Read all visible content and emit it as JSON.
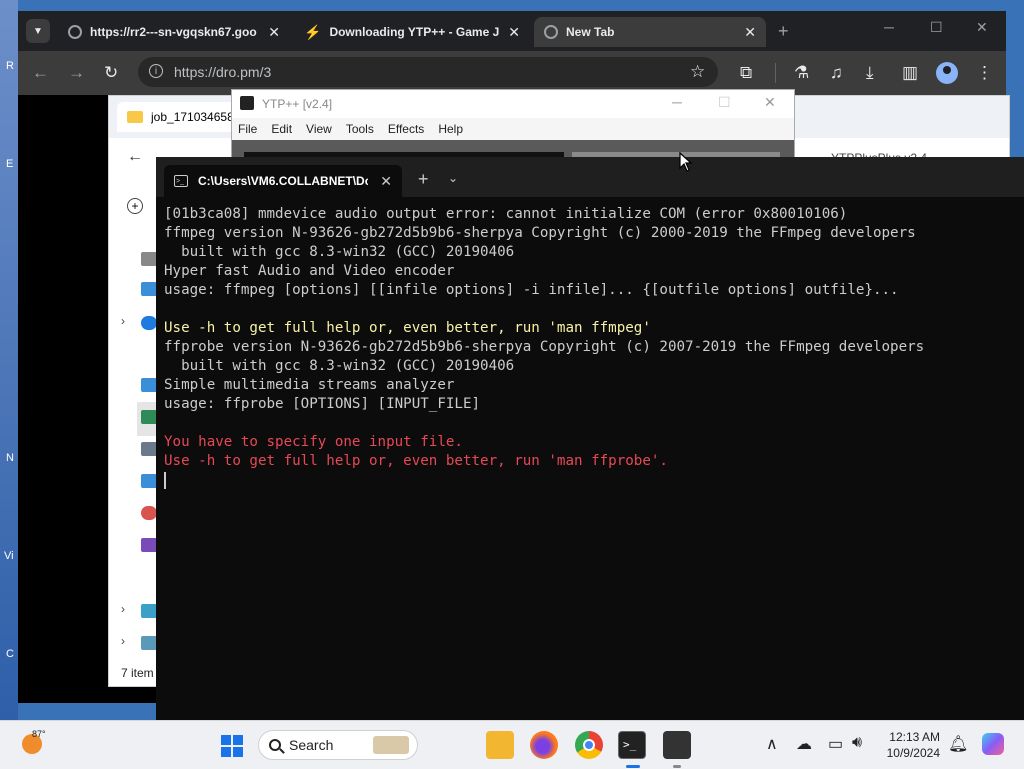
{
  "desktop": {
    "letters": [
      "R",
      "E",
      "N",
      "Vi",
      "C"
    ]
  },
  "chrome": {
    "tabs": [
      {
        "title": "https://rr2---sn-vgqskn67.goo",
        "icon": "globe-icon"
      },
      {
        "title": "Downloading YTP++ - Game J",
        "icon": "bolt-icon"
      },
      {
        "title": "New Tab",
        "icon": "globe-icon"
      }
    ],
    "address": "https://dro.pm/3",
    "icons": [
      "back-icon",
      "forward-icon",
      "reload-icon",
      "star-icon",
      "extensions-icon",
      "labs-icon",
      "media-icon",
      "download-icon",
      "sidepanel-icon",
      "profile-icon",
      "menu-icon"
    ]
  },
  "explorer": {
    "tab_title": "job_171034658",
    "right_text": "YTPPlusPlus v2.4",
    "status": "7 item"
  },
  "ytp": {
    "title": "YTP++ [v2.4]",
    "menu": [
      "File",
      "Edit",
      "View",
      "Tools",
      "Effects",
      "Help"
    ]
  },
  "terminal": {
    "tab_title": "C:\\Users\\VM6.COLLABNET\\Dc",
    "lines": [
      {
        "text": "[01b3ca08] mmdevice audio output error: cannot initialize COM (error 0x80010106)",
        "color": "white"
      },
      {
        "text": "ffmpeg version N-93626-gb272d5b9b6-sherpya Copyright (c) 2000-2019 the FFmpeg developers",
        "color": "white"
      },
      {
        "text": "  built with gcc 8.3-win32 (GCC) 20190406",
        "color": "white"
      },
      {
        "text": "Hyper fast Audio and Video encoder",
        "color": "white"
      },
      {
        "text": "usage: ffmpeg [options] [[infile options] -i infile]... {[outfile options] outfile}...",
        "color": "white"
      },
      {
        "text": "",
        "color": "white"
      },
      {
        "text": "Use -h to get full help or, even better, run 'man ffmpeg'",
        "color": "yellow"
      },
      {
        "text": "ffprobe version N-93626-gb272d5b9b6-sherpya Copyright (c) 2007-2019 the FFmpeg developers",
        "color": "white"
      },
      {
        "text": "  built with gcc 8.3-win32 (GCC) 20190406",
        "color": "white"
      },
      {
        "text": "Simple multimedia streams analyzer",
        "color": "white"
      },
      {
        "text": "usage: ffprobe [OPTIONS] [INPUT_FILE]",
        "color": "white"
      },
      {
        "text": "",
        "color": "white"
      },
      {
        "text": "You have to specify one input file.",
        "color": "red"
      },
      {
        "text": "Use -h to get full help or, even better, run 'man ffprobe'.",
        "color": "red"
      }
    ]
  },
  "taskbar": {
    "weather_temp": "87°",
    "search_placeholder": "Search",
    "time": "12:13 AM",
    "date": "10/9/2024",
    "apps": [
      "widgets-icon",
      "file-explorer-icon",
      "firefox-icon",
      "chrome-icon",
      "terminal-icon",
      "ytp-icon"
    ],
    "tray": [
      "chevron-up-icon",
      "network-off-icon",
      "display-icon",
      "volume-icon",
      "bell-icon",
      "copilot-icon"
    ]
  }
}
